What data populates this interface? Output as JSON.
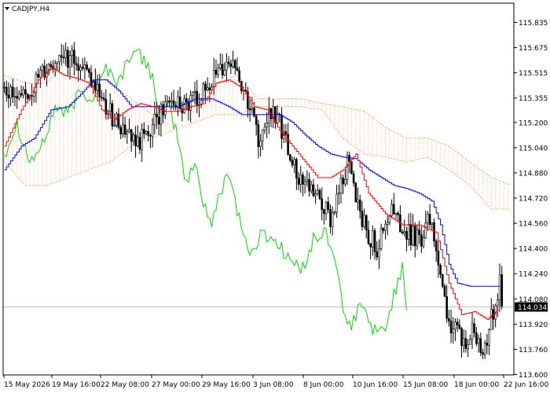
{
  "symbol_label": "CADJPY,H4",
  "current_price_label": "114.034",
  "colors": {
    "background": "#ffffff",
    "frame": "#000000",
    "candle": "#000000",
    "tenkan": "#ff0000",
    "kijun": "#0000ff",
    "chikou": "#00dd00",
    "kumo": "#f4a460",
    "price_line": "#c0c0c0",
    "price_box": "#000000"
  },
  "chart_data": {
    "type": "candlestick",
    "indicator": "Ichimoku Kinko Hyo",
    "ylim": [
      113.6,
      115.9
    ],
    "y_ticks": [
      "115.835",
      "115.675",
      "115.515",
      "115.355",
      "115.200",
      "115.040",
      "114.880",
      "114.720",
      "114.560",
      "114.400",
      "114.240",
      "114.080",
      "113.920",
      "113.760",
      "113.600"
    ],
    "x_ticks": [
      "15 May 2026",
      "19 May 16:00",
      "22 May 08:00",
      "27 May 00:00",
      "29 May 16:00",
      "3 Jun 08:00",
      "8 Jun 00:00",
      "10 Jun 16:00",
      "15 Jun 08:00",
      "18 Jun 00:00",
      "22 Jun 16:00"
    ],
    "last_price": 114.034,
    "close_trend": [
      [
        0,
        115.42
      ],
      [
        8,
        115.35
      ],
      [
        16,
        115.48
      ],
      [
        22,
        115.55
      ],
      [
        28,
        115.62
      ],
      [
        34,
        115.6
      ],
      [
        40,
        115.45
      ],
      [
        48,
        115.3
      ],
      [
        56,
        115.15
      ],
      [
        62,
        115.05
      ],
      [
        70,
        115.2
      ],
      [
        78,
        115.35
      ],
      [
        86,
        115.3
      ],
      [
        94,
        115.4
      ],
      [
        102,
        115.5
      ],
      [
        108,
        115.6
      ],
      [
        114,
        115.35
      ],
      [
        120,
        115.1
      ],
      [
        126,
        115.25
      ],
      [
        132,
        115.15
      ],
      [
        138,
        114.85
      ],
      [
        146,
        114.75
      ],
      [
        154,
        114.6
      ],
      [
        162,
        114.95
      ],
      [
        170,
        114.55
      ],
      [
        176,
        114.4
      ],
      [
        182,
        114.65
      ],
      [
        190,
        114.5
      ],
      [
        196,
        114.45
      ],
      [
        202,
        114.6
      ],
      [
        206,
        114.2
      ],
      [
        210,
        113.95
      ],
      [
        216,
        113.8
      ],
      [
        222,
        113.9
      ],
      [
        226,
        113.75
      ],
      [
        232,
        114.05
      ],
      [
        234,
        114.2
      ],
      [
        235,
        114.034
      ]
    ],
    "tenkan": [
      [
        0,
        115.05
      ],
      [
        8,
        115.28
      ],
      [
        16,
        115.47
      ],
      [
        22,
        115.55
      ],
      [
        28,
        115.5
      ],
      [
        34,
        115.48
      ],
      [
        40,
        115.45
      ],
      [
        46,
        115.28
      ],
      [
        52,
        115.22
      ],
      [
        58,
        115.28
      ],
      [
        64,
        115.32
      ],
      [
        70,
        115.3
      ],
      [
        76,
        115.27
      ],
      [
        82,
        115.27
      ],
      [
        88,
        115.3
      ],
      [
        94,
        115.32
      ],
      [
        100,
        115.45
      ],
      [
        106,
        115.47
      ],
      [
        112,
        115.42
      ],
      [
        118,
        115.3
      ],
      [
        124,
        115.28
      ],
      [
        130,
        115.15
      ],
      [
        136,
        115.05
      ],
      [
        142,
        114.95
      ],
      [
        148,
        114.85
      ],
      [
        154,
        114.85
      ],
      [
        160,
        114.9
      ],
      [
        166,
        115.0
      ],
      [
        172,
        114.75
      ],
      [
        180,
        114.62
      ],
      [
        188,
        114.55
      ],
      [
        196,
        114.55
      ],
      [
        204,
        114.5
      ],
      [
        210,
        114.18
      ],
      [
        216,
        113.98
      ],
      [
        222,
        114.0
      ],
      [
        228,
        113.95
      ],
      [
        234,
        114.02
      ]
    ],
    "kijun": [
      [
        0,
        114.9
      ],
      [
        8,
        115.05
      ],
      [
        14,
        115.1
      ],
      [
        22,
        115.28
      ],
      [
        30,
        115.3
      ],
      [
        36,
        115.38
      ],
      [
        42,
        115.47
      ],
      [
        48,
        115.47
      ],
      [
        54,
        115.4
      ],
      [
        60,
        115.3
      ],
      [
        68,
        115.3
      ],
      [
        76,
        115.3
      ],
      [
        82,
        115.3
      ],
      [
        90,
        115.35
      ],
      [
        98,
        115.35
      ],
      [
        106,
        115.3
      ],
      [
        112,
        115.25
      ],
      [
        118,
        115.25
      ],
      [
        124,
        115.25
      ],
      [
        130,
        115.25
      ],
      [
        136,
        115.2
      ],
      [
        142,
        115.12
      ],
      [
        148,
        115.05
      ],
      [
        154,
        115.0
      ],
      [
        160,
        114.98
      ],
      [
        166,
        114.97
      ],
      [
        172,
        114.9
      ],
      [
        178,
        114.85
      ],
      [
        184,
        114.8
      ],
      [
        190,
        114.78
      ],
      [
        196,
        114.75
      ],
      [
        202,
        114.7
      ],
      [
        206,
        114.55
      ],
      [
        210,
        114.3
      ],
      [
        214,
        114.18
      ],
      [
        220,
        114.16
      ],
      [
        228,
        114.16
      ],
      [
        234,
        114.16
      ]
    ],
    "chikou": [
      [
        0,
        115.0
      ],
      [
        6,
        115.2
      ],
      [
        12,
        114.95
      ],
      [
        18,
        115.05
      ],
      [
        24,
        115.3
      ],
      [
        30,
        115.25
      ],
      [
        36,
        115.4
      ],
      [
        42,
        115.35
      ],
      [
        48,
        115.55
      ],
      [
        54,
        115.45
      ],
      [
        60,
        115.65
      ],
      [
        66,
        115.6
      ],
      [
        70,
        115.5
      ],
      [
        74,
        115.2
      ],
      [
        78,
        115.3
      ],
      [
        82,
        115.1
      ],
      [
        86,
        114.8
      ],
      [
        90,
        114.95
      ],
      [
        94,
        114.7
      ],
      [
        98,
        114.55
      ],
      [
        102,
        114.75
      ],
      [
        106,
        114.9
      ],
      [
        110,
        114.65
      ],
      [
        116,
        114.35
      ],
      [
        122,
        114.5
      ],
      [
        128,
        114.45
      ],
      [
        134,
        114.35
      ],
      [
        140,
        114.25
      ],
      [
        146,
        114.45
      ],
      [
        152,
        114.5
      ],
      [
        158,
        114.25
      ],
      [
        160,
        113.95
      ],
      [
        164,
        113.9
      ],
      [
        168,
        114.05
      ],
      [
        172,
        113.95
      ],
      [
        176,
        113.85
      ],
      [
        180,
        113.9
      ],
      [
        184,
        114.1
      ],
      [
        188,
        114.3
      ],
      [
        190,
        114.05
      ]
    ],
    "kumo_a": [
      [
        0,
        115.5
      ],
      [
        10,
        115.45
      ],
      [
        20,
        115.45
      ],
      [
        30,
        115.6
      ],
      [
        40,
        115.55
      ],
      [
        50,
        115.45
      ],
      [
        60,
        115.35
      ],
      [
        70,
        115.25
      ],
      [
        80,
        115.3
      ],
      [
        90,
        115.35
      ],
      [
        100,
        115.45
      ],
      [
        110,
        115.5
      ],
      [
        120,
        115.35
      ],
      [
        130,
        115.35
      ],
      [
        140,
        115.35
      ],
      [
        150,
        115.32
      ],
      [
        160,
        115.3
      ],
      [
        170,
        115.27
      ],
      [
        180,
        115.17
      ],
      [
        190,
        115.1
      ],
      [
        200,
        115.1
      ],
      [
        210,
        115.05
      ],
      [
        220,
        114.95
      ],
      [
        230,
        114.85
      ],
      [
        240,
        114.8
      ]
    ],
    "kumo_b": [
      [
        0,
        114.95
      ],
      [
        10,
        114.8
      ],
      [
        20,
        114.8
      ],
      [
        30,
        114.85
      ],
      [
        40,
        114.9
      ],
      [
        50,
        114.95
      ],
      [
        60,
        115.05
      ],
      [
        70,
        115.1
      ],
      [
        80,
        115.15
      ],
      [
        90,
        115.2
      ],
      [
        100,
        115.25
      ],
      [
        110,
        115.25
      ],
      [
        120,
        115.3
      ],
      [
        130,
        115.3
      ],
      [
        140,
        115.3
      ],
      [
        150,
        115.28
      ],
      [
        160,
        115.1
      ],
      [
        170,
        115.0
      ],
      [
        180,
        114.98
      ],
      [
        190,
        114.95
      ],
      [
        200,
        114.98
      ],
      [
        210,
        114.9
      ],
      [
        220,
        114.8
      ],
      [
        230,
        114.65
      ],
      [
        240,
        114.65
      ]
    ]
  }
}
